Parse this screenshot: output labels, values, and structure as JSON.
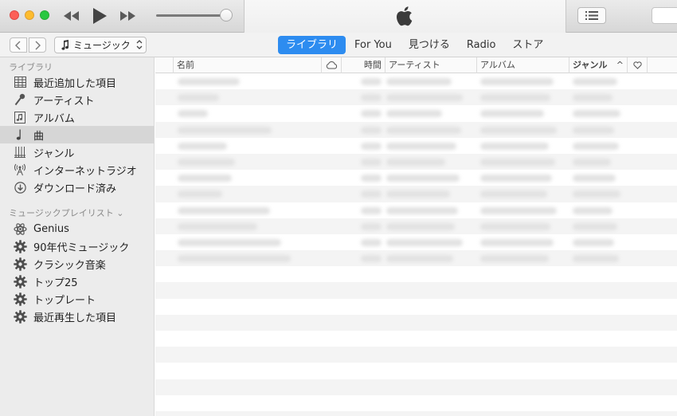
{
  "window": {
    "title": "",
    "colors": {
      "close": "#fc5f57",
      "minimize": "#fdbc2e",
      "maximize": "#28c840",
      "accent": "#2d8cf0"
    }
  },
  "toolbar": {
    "icons": [
      "rewind-icon",
      "play-icon",
      "fast-forward-icon",
      "apple-logo-icon",
      "list-view-icon"
    ],
    "volume": 0.92
  },
  "nav": {
    "media_type": "ミュージック",
    "tabs": [
      {
        "label": "ライブラリ",
        "active": true
      },
      {
        "label": "For You",
        "active": false
      },
      {
        "label": "見つける",
        "active": false
      },
      {
        "label": "Radio",
        "active": false
      },
      {
        "label": "ストア",
        "active": false
      }
    ]
  },
  "sidebar": {
    "library_header": "ライブラリ",
    "library_items": [
      {
        "label": "最近追加した項目",
        "icon": "grid-icon",
        "active": false
      },
      {
        "label": "アーティスト",
        "icon": "microphone-icon",
        "active": false
      },
      {
        "label": "アルバム",
        "icon": "album-icon",
        "active": false
      },
      {
        "label": "曲",
        "icon": "music-note-icon",
        "active": true
      },
      {
        "label": "ジャンル",
        "icon": "guitar-icon",
        "active": false
      },
      {
        "label": "インターネットラジオ",
        "icon": "radio-antenna-icon",
        "active": false
      },
      {
        "label": "ダウンロード済み",
        "icon": "download-icon",
        "active": false
      }
    ],
    "playlists_header": "ミュージックプレイリスト ⌄",
    "playlists": [
      {
        "label": "Genius",
        "icon": "genius-atom-icon"
      },
      {
        "label": "90年代ミュージック",
        "icon": "gear-icon"
      },
      {
        "label": "クラシック音楽",
        "icon": "gear-icon"
      },
      {
        "label": "トップ25",
        "icon": "gear-icon"
      },
      {
        "label": "トップレート",
        "icon": "gear-icon"
      },
      {
        "label": "最近再生した項目",
        "icon": "gear-icon"
      }
    ]
  },
  "songs": {
    "columns": {
      "name": "名前",
      "cloud": "cloud-icon",
      "time": "時間",
      "artist": "アーティスト",
      "album": "アルバム",
      "genre": "ジャンル",
      "sort_indicator": "^",
      "love": "heart-icon"
    },
    "row_count": 12,
    "rows_blurred": true
  }
}
